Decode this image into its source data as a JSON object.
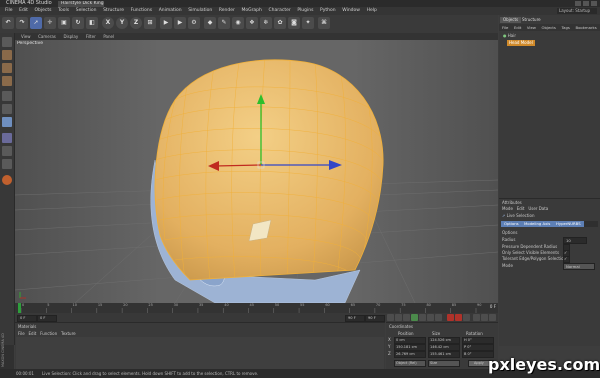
{
  "app": {
    "window_title": "CINEMA 4D Studio",
    "document_tab": "Hairstyle Dick King.c4d"
  },
  "menus": [
    "File",
    "Edit",
    "Objects",
    "Tools",
    "Selection",
    "Structure",
    "Functions",
    "Animation",
    "Simulation",
    "Render",
    "MoGraph",
    "Character",
    "Plugins",
    "Python",
    "Window",
    "Help"
  ],
  "layout_label": "Layout: Startup",
  "toolbar": {
    "axis_buttons": [
      "X",
      "Y",
      "Z"
    ]
  },
  "viewport": {
    "menu": [
      "View",
      "Cameras",
      "Display",
      "Filter",
      "Panel"
    ],
    "label": "Perspective"
  },
  "object_manager": {
    "tabs": [
      "Objects",
      "Structure"
    ],
    "menu": [
      "File",
      "Edit",
      "View",
      "Objects",
      "Tags",
      "Bookmarks"
    ],
    "items": [
      "Hair",
      "Head Model"
    ]
  },
  "attributes": {
    "header": "Attributes",
    "menu": [
      "Mode",
      "Edit",
      "User Data"
    ],
    "tool_name": "Live Selection",
    "tabs": [
      "Options",
      "Modeling Axis",
      "HyperNURBS"
    ],
    "section": "Options",
    "rows": [
      {
        "label": "Radius",
        "value": "10"
      },
      {
        "label": "Pressure Dependent Radius",
        "value": ""
      },
      {
        "label": "Only Select Visible Elements",
        "value": "✓"
      },
      {
        "label": "Tolerant Edge/Polygon Selection",
        "value": "✓"
      },
      {
        "label": "Mode",
        "value": "Normal"
      }
    ]
  },
  "timeline": {
    "start": "0 F",
    "end": "90 F",
    "ticks": [
      "0",
      "5",
      "10",
      "15",
      "20",
      "25",
      "30",
      "35",
      "40",
      "45",
      "50",
      "55",
      "60",
      "65",
      "70",
      "75",
      "80",
      "85",
      "90"
    ]
  },
  "materials": {
    "header": "Materials",
    "menu": [
      "File",
      "Edit",
      "Function",
      "Texture"
    ]
  },
  "coordinates": {
    "header": "Coordinates",
    "columns": [
      "Position",
      "Size",
      "Rotation"
    ],
    "rows": [
      {
        "axis": "X",
        "pos": "0 cm",
        "size": "124.526 cm",
        "rot": "H 0°"
      },
      {
        "axis": "Y",
        "pos": "150.181 cm",
        "size": "146.42 cm",
        "rot": "P 0°"
      },
      {
        "axis": "Z",
        "pos": "26.769 cm",
        "size": "155.461 cm",
        "rot": "B 0°"
      }
    ],
    "mode": "Object (Rel)",
    "size_mode": "Size",
    "apply": "Apply"
  },
  "status": {
    "time": "00:00:01",
    "text": "Live Selection: Click and drag to select elements. Hold down SHIFT to add to the selection, CTRL to remove."
  },
  "side_logo": "MAXON CINEMA 4D",
  "colors": {
    "head_fill": "#e8b766",
    "wire": "#f0b03a",
    "body_blue": "#9db3d4",
    "axis_y": "#2bbf2b",
    "axis_x": "#c02a1f",
    "axis_z": "#3246c8",
    "ui_bg": "#3d3d3d"
  },
  "watermark": "pxleyes.com"
}
